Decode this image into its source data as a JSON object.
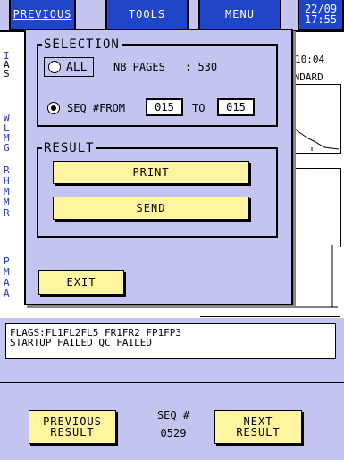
{
  "tabs": {
    "previous": "PREVIOUS",
    "tools": "TOOLS",
    "menu": "MENU"
  },
  "clock": {
    "date": "22/09",
    "time": "17:55"
  },
  "background": {
    "time_readout": "10:04",
    "mode_label": "ANDARD",
    "side_letters": [
      "I",
      "A",
      "S",
      "W",
      "L",
      "M",
      "G",
      "R",
      "H",
      "M",
      "M",
      "R",
      "P",
      "M",
      "A",
      "A"
    ]
  },
  "dialog": {
    "selection_title": "SELECTION",
    "all_label": "ALL",
    "nb_pages_label": "NB PAGES",
    "nb_pages_value": ": 530",
    "seq_label": "SEQ #FROM",
    "seq_from": "015",
    "to_label": "TO",
    "seq_to": "015",
    "all_selected": false,
    "seq_selected": true,
    "result_title": "RESULT",
    "print_label": "PRINT",
    "send_label": "SEND",
    "exit_label": "EXIT"
  },
  "flags": {
    "line1": "FLAGS:FL1FL2FL5 FR1FR2 FP1FP3",
    "line2": "STARTUP FAILED QC FAILED"
  },
  "bottom": {
    "prev_result_line1": "PREVIOUS",
    "prev_result_line2": "RESULT",
    "seq_label": "SEQ #",
    "seq_value": "0529",
    "next_result_line1": "NEXT",
    "next_result_line2": "RESULT"
  },
  "colors": {
    "tab_blue": "#1f46c8",
    "panel_lilac": "#c4c4f0",
    "button_yellow": "#fff4a0"
  }
}
